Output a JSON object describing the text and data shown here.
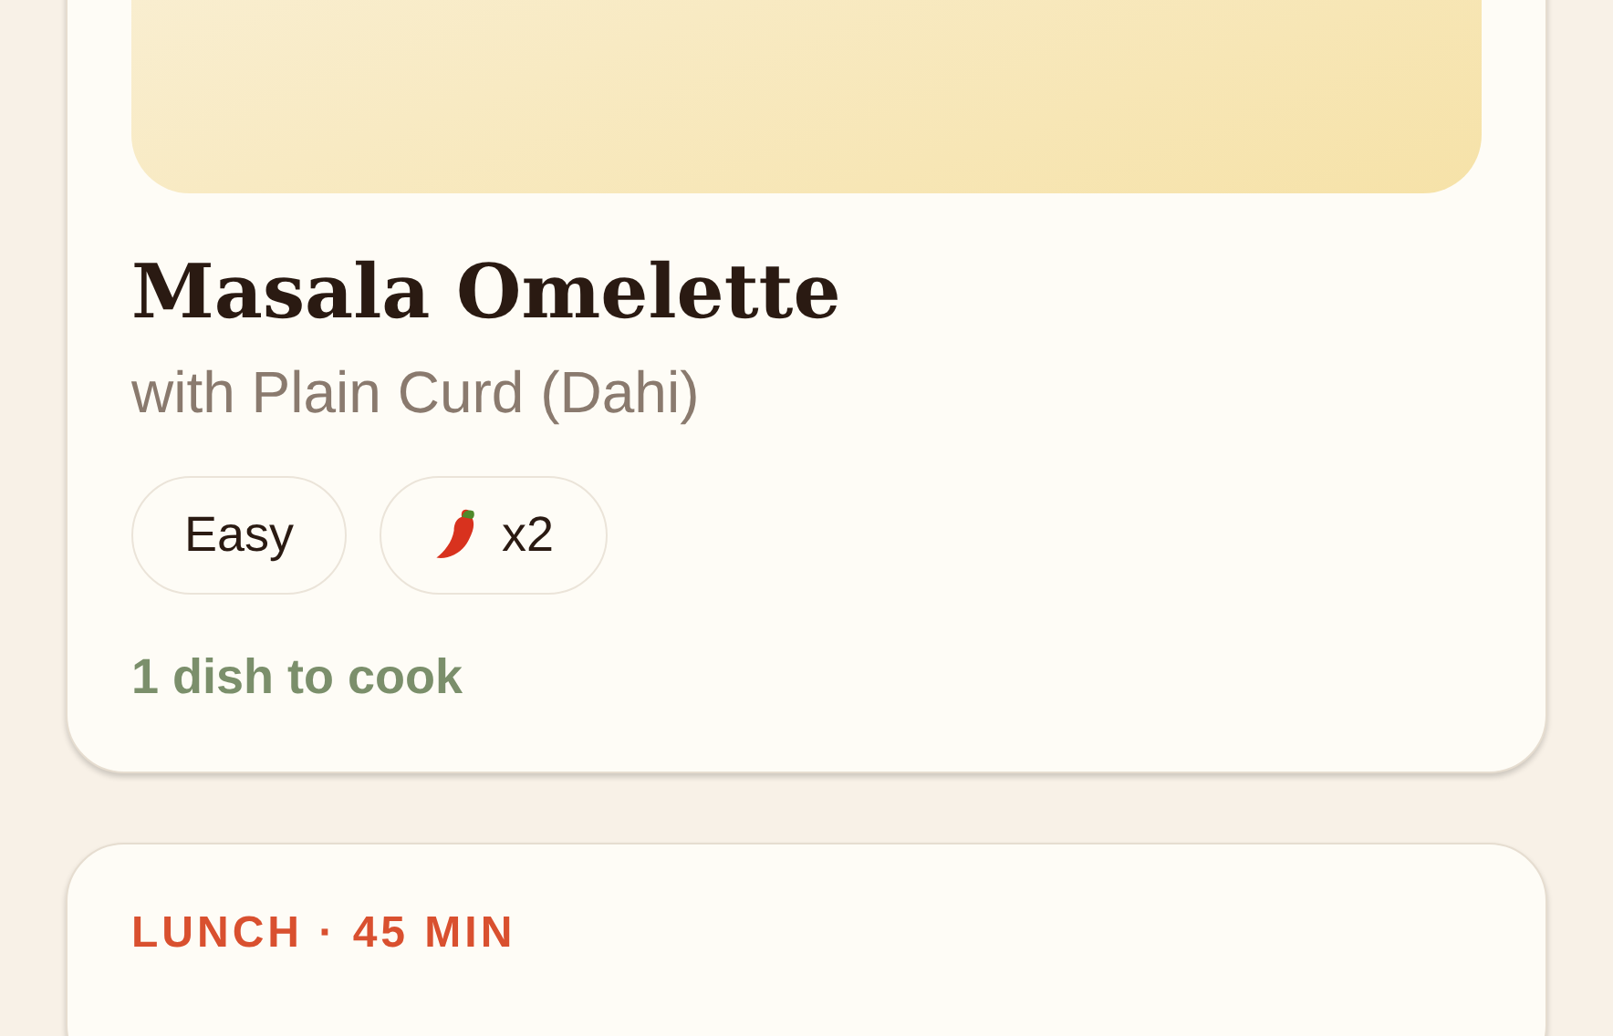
{
  "cards": [
    {
      "kind": "dish",
      "title": "Masala Omelette",
      "subtitle": "with Plain Curd (Dahi)",
      "tags": [
        {
          "kind": "text",
          "label": "Easy"
        },
        {
          "kind": "spice",
          "label": "x2"
        }
      ],
      "footnote": "1 dish to cook"
    },
    {
      "kind": "teaser",
      "meal": "LUNCH · 45 MIN"
    }
  ]
}
